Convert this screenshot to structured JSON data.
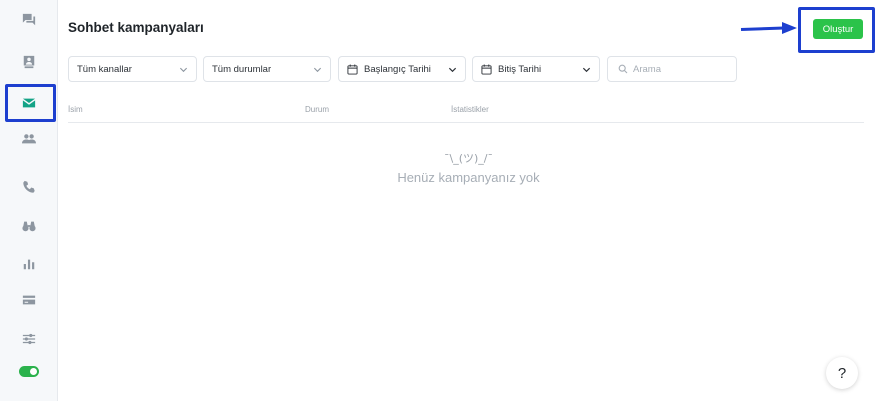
{
  "header": {
    "title": "Sohbet kampanyaları",
    "create_label": "Oluştur"
  },
  "sidebar": {
    "items": [
      {
        "icon": "chat-icon"
      },
      {
        "icon": "contact-card-icon"
      },
      {
        "icon": "mail-icon",
        "active": true
      },
      {
        "icon": "people-icon"
      },
      {
        "icon": "phone-icon"
      },
      {
        "icon": "binoculars-icon"
      },
      {
        "icon": "bar-chart-icon"
      },
      {
        "icon": "credit-card-icon"
      },
      {
        "icon": "sliders-icon"
      }
    ],
    "toggle_on": true
  },
  "filters": {
    "channels": "Tüm kanallar",
    "statuses": "Tüm durumlar",
    "start_date": "Başlangıç Tarihi",
    "end_date": "Bitiş Tarihi",
    "search_placeholder": "Arama"
  },
  "table": {
    "columns": [
      "İsim",
      "Durum",
      "İstatistikler"
    ]
  },
  "empty_state": {
    "shrug": "¯\\_(ツ)_/¯",
    "message": "Henüz kampanyanız yok"
  },
  "help": {
    "label": "?"
  },
  "colors": {
    "accent": "#13a386",
    "create_button": "#2bc34a",
    "highlight": "#1d3fcf"
  }
}
